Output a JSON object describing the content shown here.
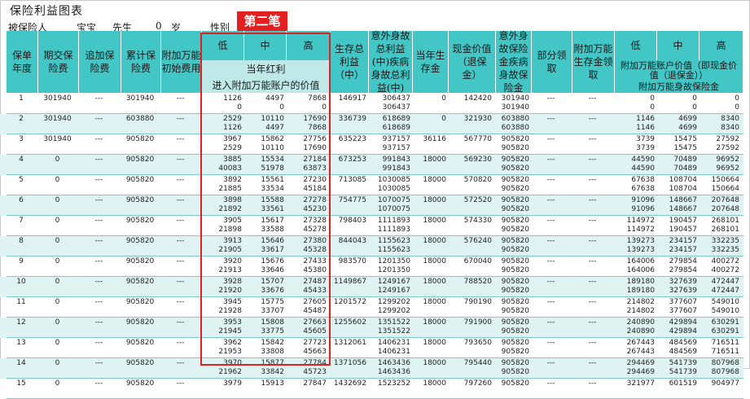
{
  "title": "保险利益图表",
  "tag": "第二笔",
  "meta": {
    "insured_label": "被保险人",
    "insured_name": "宝宝",
    "honorific": "先生",
    "age": "0",
    "age_unit": "岁",
    "gender_label": "性别"
  },
  "headers": {
    "policy_year": "保单年度",
    "period_premium": "期交保险费",
    "additional_premium": "追加保险费",
    "cumulative_premium": "累计保险费",
    "rider_initial_fee": "附加万能初始费用",
    "low": "低",
    "mid": "中",
    "high": "高",
    "current_bonus": "当年红利",
    "into_account": "进入附加万能账户的价值",
    "survival_total": "生存总利益（中）",
    "accident_death": "意外身故总利益(中)疾病身故总利益(中)",
    "survival_fund": "当年生存金",
    "cash_value": "现金价值（退保金）",
    "accident_death_insured": "意外身故保险金疾病身故保险金",
    "partial_withdraw": "部分领取",
    "rider_survival": "附加万能生存金领取",
    "rider_low": "低",
    "rider_mid": "中",
    "rider_high": "高",
    "rider_account_value": "附加万能账户价值（即现金价值（退保金））",
    "rider_death": "附加万能身故保险金"
  },
  "rows": [
    {
      "year": "1",
      "prem": "301940",
      "add": "---",
      "cum": "301940",
      "fee": "---",
      "b": [
        "1126",
        "4497",
        "7868"
      ],
      "v": [
        "0",
        "0",
        "0"
      ],
      "surv": "146917",
      "death": [
        "306437",
        "306437"
      ],
      "sf": "0",
      "cash": "142420",
      "dins": [
        "301940",
        "301940"
      ],
      "pw": "---",
      "rs": "---",
      "ra": [
        "0",
        "0",
        "0"
      ],
      "rd": [
        "0",
        "0",
        "0"
      ]
    },
    {
      "year": "2",
      "prem": "301940",
      "add": "---",
      "cum": "603880",
      "fee": "---",
      "b": [
        "2529",
        "10110",
        "17690"
      ],
      "v": [
        "1126",
        "4497",
        "7868"
      ],
      "surv": "336739",
      "death": [
        "618689",
        "618689"
      ],
      "sf": "0",
      "cash": "321930",
      "dins": [
        "603880",
        "603880"
      ],
      "pw": "---",
      "rs": "---",
      "ra": [
        "1146",
        "4699",
        "8340"
      ],
      "rd": [
        "1146",
        "4699",
        "8340"
      ]
    },
    {
      "year": "3",
      "prem": "301940",
      "add": "---",
      "cum": "905820",
      "fee": "---",
      "b": [
        "3967",
        "15862",
        "27756"
      ],
      "v": [
        "2529",
        "10110",
        "17690"
      ],
      "surv": "635223",
      "death": [
        "937157",
        "937157"
      ],
      "sf": "36116",
      "cash": "567770",
      "dins": [
        "905820",
        "905820"
      ],
      "pw": "---",
      "rs": "---",
      "ra": [
        "3739",
        "15475",
        "27592"
      ],
      "rd": [
        "3739",
        "15475",
        "27592"
      ]
    },
    {
      "year": "4",
      "prem": "0",
      "add": "---",
      "cum": "905820",
      "fee": "---",
      "b": [
        "3885",
        "15534",
        "27184"
      ],
      "v": [
        "40083",
        "51978",
        "63873"
      ],
      "surv": "673253",
      "death": [
        "991843",
        "991843"
      ],
      "sf": "18000",
      "cash": "569230",
      "dins": [
        "905820",
        "905820"
      ],
      "pw": "---",
      "rs": "---",
      "ra": [
        "44590",
        "70489",
        "96952"
      ],
      "rd": [
        "44590",
        "70489",
        "96952"
      ]
    },
    {
      "year": "5",
      "prem": "0",
      "add": "---",
      "cum": "905820",
      "fee": "---",
      "b": [
        "3892",
        "15561",
        "27230"
      ],
      "v": [
        "21885",
        "33534",
        "45184"
      ],
      "surv": "713085",
      "death": [
        "1030085",
        "1030085"
      ],
      "sf": "18000",
      "cash": "570820",
      "dins": [
        "905820",
        "905820"
      ],
      "pw": "---",
      "rs": "---",
      "ra": [
        "67638",
        "108704",
        "150664"
      ],
      "rd": [
        "67638",
        "108704",
        "150664"
      ]
    },
    {
      "year": "6",
      "prem": "0",
      "add": "---",
      "cum": "905820",
      "fee": "---",
      "b": [
        "3898",
        "15588",
        "27278"
      ],
      "v": [
        "21892",
        "33561",
        "45230"
      ],
      "surv": "754775",
      "death": [
        "1070075",
        "1070075"
      ],
      "sf": "18000",
      "cash": "572520",
      "dins": [
        "905820",
        "905820"
      ],
      "pw": "---",
      "rs": "---",
      "ra": [
        "91096",
        "148667",
        "207648"
      ],
      "rd": [
        "91096",
        "148667",
        "207648"
      ]
    },
    {
      "year": "7",
      "prem": "0",
      "add": "---",
      "cum": "905820",
      "fee": "---",
      "b": [
        "3905",
        "15617",
        "27328"
      ],
      "v": [
        "21898",
        "33588",
        "45278"
      ],
      "surv": "798403",
      "death": [
        "1111893",
        "1111893"
      ],
      "sf": "18000",
      "cash": "574330",
      "dins": [
        "905820",
        "905820"
      ],
      "pw": "---",
      "rs": "---",
      "ra": [
        "114972",
        "190457",
        "268101"
      ],
      "rd": [
        "114972",
        "190457",
        "268101"
      ]
    },
    {
      "year": "8",
      "prem": "0",
      "add": "---",
      "cum": "905820",
      "fee": "---",
      "b": [
        "3913",
        "15646",
        "27380"
      ],
      "v": [
        "21905",
        "33617",
        "45328"
      ],
      "surv": "844043",
      "death": [
        "1155623",
        "1155623"
      ],
      "sf": "18000",
      "cash": "576240",
      "dins": [
        "905820",
        "905820"
      ],
      "pw": "---",
      "rs": "---",
      "ra": [
        "139273",
        "234157",
        "332235"
      ],
      "rd": [
        "139273",
        "234157",
        "332235"
      ]
    },
    {
      "year": "9",
      "prem": "0",
      "add": "---",
      "cum": "905820",
      "fee": "---",
      "b": [
        "3920",
        "15676",
        "27433"
      ],
      "v": [
        "21913",
        "33646",
        "45380"
      ],
      "surv": "983570",
      "death": [
        "1201350",
        "1201350"
      ],
      "sf": "18000",
      "cash": "670040",
      "dins": [
        "905820",
        "905820"
      ],
      "pw": "---",
      "rs": "---",
      "ra": [
        "164006",
        "279854",
        "400272"
      ],
      "rd": [
        "164006",
        "279854",
        "400272"
      ]
    },
    {
      "year": "10",
      "prem": "0",
      "add": "---",
      "cum": "905820",
      "fee": "---",
      "b": [
        "3928",
        "15707",
        "27487"
      ],
      "v": [
        "21920",
        "33676",
        "45433"
      ],
      "surv": "1149867",
      "death": [
        "1249167",
        "1249167"
      ],
      "sf": "18000",
      "cash": "788520",
      "dins": [
        "905820",
        "905820"
      ],
      "pw": "---",
      "rs": "---",
      "ra": [
        "189180",
        "327639",
        "472447"
      ],
      "rd": [
        "189180",
        "327639",
        "472447"
      ]
    },
    {
      "year": "11",
      "prem": "0",
      "add": "---",
      "cum": "905820",
      "fee": "---",
      "b": [
        "3945",
        "15775",
        "27605"
      ],
      "v": [
        "21928",
        "33707",
        "45487"
      ],
      "surv": "1201572",
      "death": [
        "1299202",
        "1299202"
      ],
      "sf": "18000",
      "cash": "790190",
      "dins": [
        "905820",
        "905820"
      ],
      "pw": "---",
      "rs": "---",
      "ra": [
        "214802",
        "377607",
        "549010"
      ],
      "rd": [
        "214802",
        "377607",
        "549010"
      ]
    },
    {
      "year": "12",
      "prem": "0",
      "add": "---",
      "cum": "905820",
      "fee": "---",
      "b": [
        "3953",
        "15808",
        "27663"
      ],
      "v": [
        "21945",
        "33775",
        "45605"
      ],
      "surv": "1255602",
      "death": [
        "1351522",
        "1351522"
      ],
      "sf": "18000",
      "cash": "791900",
      "dins": [
        "905820",
        "905820"
      ],
      "pw": "---",
      "rs": "---",
      "ra": [
        "240890",
        "429894",
        "630291"
      ],
      "rd": [
        "240890",
        "429894",
        "630291"
      ]
    },
    {
      "year": "13",
      "prem": "0",
      "add": "---",
      "cum": "905820",
      "fee": "---",
      "b": [
        "3962",
        "15842",
        "27723"
      ],
      "v": [
        "21953",
        "33808",
        "45663"
      ],
      "surv": "1312061",
      "death": [
        "1406231",
        "1406231"
      ],
      "sf": "18000",
      "cash": "793650",
      "dins": [
        "905820",
        "905820"
      ],
      "pw": "---",
      "rs": "---",
      "ra": [
        "267443",
        "484569",
        "716511"
      ],
      "rd": [
        "267443",
        "484569",
        "716511"
      ]
    },
    {
      "year": "14",
      "prem": "0",
      "add": "---",
      "cum": "905820",
      "fee": "---",
      "b": [
        "3970",
        "15877",
        "27784"
      ],
      "v": [
        "21962",
        "33842",
        "45723"
      ],
      "surv": "1371056",
      "death": [
        "1463436",
        "1463436"
      ],
      "sf": "18000",
      "cash": "795440",
      "dins": [
        "905820",
        "905820"
      ],
      "pw": "---",
      "rs": "---",
      "ra": [
        "294469",
        "541739",
        "807968"
      ],
      "rd": [
        "294469",
        "541739",
        "807968"
      ]
    },
    {
      "year": "15",
      "prem": "0",
      "add": "---",
      "cum": "905820",
      "fee": "---",
      "b": [
        "3979",
        "15913",
        "27847"
      ],
      "v": [],
      "surv": "1432692",
      "death": [
        "1523252"
      ],
      "sf": "18000",
      "cash": "797260",
      "dins": [
        "905820"
      ],
      "pw": "---",
      "rs": "---",
      "ra": [
        "321977",
        "601519",
        "904977"
      ],
      "rd": []
    }
  ],
  "colors": {
    "header": "#43c6c6",
    "header_light": "#bfe9e9",
    "alt_row": "#dff3f3",
    "highlight": "#e02020"
  }
}
